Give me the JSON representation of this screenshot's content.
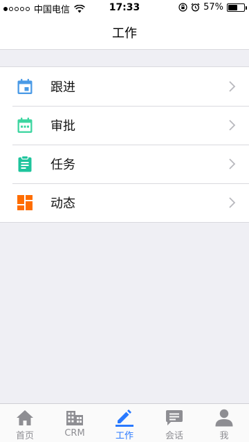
{
  "status": {
    "carrier": "中国电信",
    "time": "17:33",
    "battery": "57%",
    "battery_level": 0.57
  },
  "nav": {
    "title": "工作"
  },
  "menu": {
    "items": [
      {
        "label": "跟进",
        "icon": "calendar-icon",
        "color": "#4a9ae6"
      },
      {
        "label": "审批",
        "icon": "calendar-dots-icon",
        "color": "#3dd5a0"
      },
      {
        "label": "任务",
        "icon": "clipboard-icon",
        "color": "#1ec49c"
      },
      {
        "label": "动态",
        "icon": "dashboard-icon",
        "color": "#ff6d00"
      }
    ]
  },
  "tabs": [
    {
      "label": "首页",
      "icon": "home-icon"
    },
    {
      "label": "CRM",
      "icon": "building-icon"
    },
    {
      "label": "工作",
      "icon": "edit-icon",
      "active": true
    },
    {
      "label": "会话",
      "icon": "chat-icon"
    },
    {
      "label": "我",
      "icon": "person-icon"
    }
  ],
  "colors": {
    "accent": "#2979ff",
    "inactive": "#8e8e93"
  }
}
